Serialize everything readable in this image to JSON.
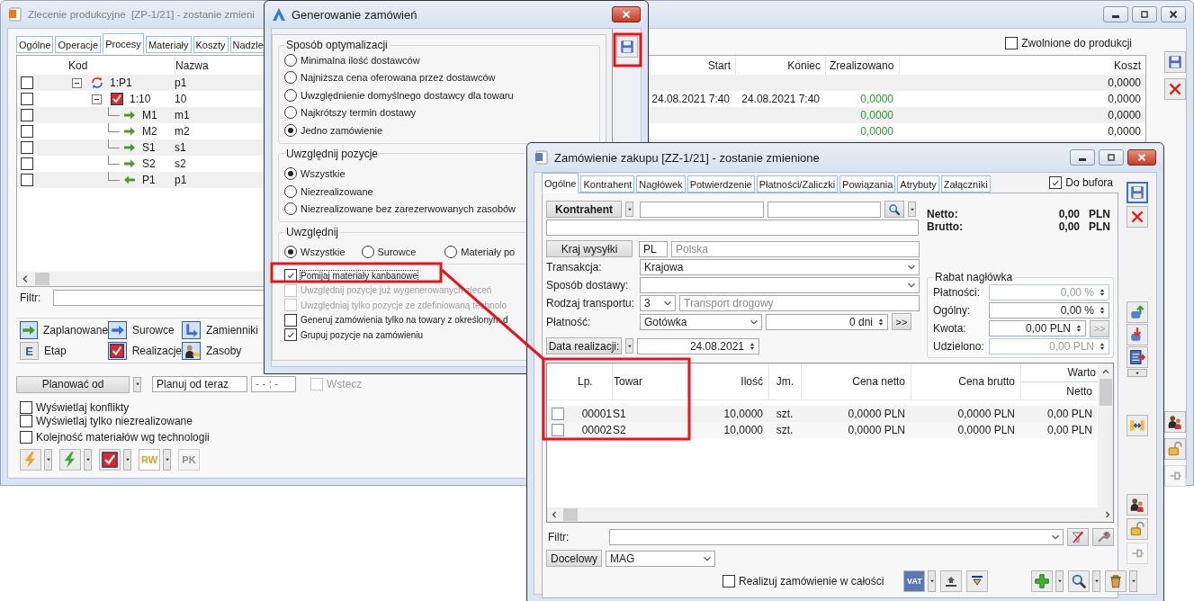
{
  "production_order_window": {
    "title": "Zlecenie produkcyjne  [ZP-1/21] - zostanie zmieni",
    "tabs": [
      {
        "label": "Ogólne",
        "selected": false
      },
      {
        "label": "Operacje",
        "selected": false
      },
      {
        "label": "Procesy",
        "selected": true
      },
      {
        "label": "Materiały",
        "selected": false
      },
      {
        "label": "Koszty",
        "selected": false
      },
      {
        "label": "Nadzle",
        "selected": false
      }
    ],
    "released": {
      "label": "Zwolnione do produkcji",
      "checked": false
    },
    "columns": [
      "Kod",
      "Nazwa",
      "Start",
      "Koniec",
      "Zrealizowano",
      "Koszt"
    ],
    "tree": [
      {
        "kind": "process",
        "code": "1:P1",
        "name": "p1",
        "checked": false,
        "expanded": true,
        "cost": "0,0000",
        "children": [
          {
            "kind": "operation",
            "code": "1:10",
            "name": "10",
            "checked": false,
            "expanded": true,
            "start": "24.08.2021 7:40",
            "end": "24.08.2021 7:40",
            "done": "0,0000",
            "cost": "0,0000",
            "children": [
              {
                "kind": "input",
                "code": "M1",
                "name": "m1",
                "checked": false,
                "done": "0,0000",
                "cost": "0,0000"
              },
              {
                "kind": "input",
                "code": "M2",
                "name": "m2",
                "checked": false,
                "done": "0,0000",
                "cost": "0,0000"
              },
              {
                "kind": "input",
                "code": "S1",
                "name": "s1",
                "checked": false
              },
              {
                "kind": "input",
                "code": "S2",
                "name": "s2",
                "checked": false
              },
              {
                "kind": "output",
                "code": "P1",
                "name": "p1",
                "checked": false
              }
            ]
          }
        ]
      }
    ],
    "filter_label": "Filtr:",
    "legend": [
      {
        "label": "Zaplanowane",
        "kind": "planned"
      },
      {
        "label": "Surowce",
        "kind": "raw"
      },
      {
        "label": "Zamienniki",
        "kind": "substitutes"
      },
      {
        "label": "Etap",
        "kind": "stage",
        "glyph": "E"
      },
      {
        "label": "Realizacje",
        "kind": "realization"
      },
      {
        "label": "Zasoby",
        "kind": "resources"
      }
    ],
    "plan_button": "Planować od",
    "plan_mode": "Planuj od teraz",
    "plan_time": "- - : -",
    "backward": {
      "label": "Wstecz",
      "checked": false,
      "disabled": true
    },
    "options": [
      {
        "label": "Wyświetlaj konflikty",
        "checked": false
      },
      {
        "label": "Wyświetlaj tylko niezrealizowane",
        "checked": false
      },
      {
        "label": "Kolejność materiałów wg technologii",
        "checked": false
      }
    ],
    "tools": [
      {
        "kind": "lightning",
        "color": "#f0a028",
        "dropdown": true,
        "disabled": false
      },
      {
        "kind": "lightning",
        "color": "#38a838",
        "dropdown": true,
        "disabled": false
      },
      {
        "kind": "realization",
        "dropdown": true,
        "disabled": false
      },
      {
        "kind": "document",
        "glyph": "RW",
        "dropdown": true,
        "disabled": false
      },
      {
        "kind": "document",
        "glyph": "PK",
        "dropdown": false,
        "disabled": true
      }
    ],
    "side_tools": [
      [
        {
          "kind": "save",
          "disabled": false
        },
        {
          "kind": "delete",
          "disabled": false
        }
      ],
      [
        {
          "kind": "people",
          "disabled": false
        },
        {
          "kind": "lock",
          "disabled": false
        },
        {
          "kind": "pin",
          "disabled": true
        }
      ]
    ]
  },
  "dialog": {
    "title": "Generowanie zamówień",
    "groups": [
      {
        "title": "Sposób optymalizacji",
        "kind": "column",
        "options": [
          {
            "label": "Minimalna ilość dostawców",
            "selected": false
          },
          {
            "label": "Najniższa cena oferowana przez dostawców",
            "selected": false
          },
          {
            "label": "Uwzględnienie domyślnego dostawcy dla towaru",
            "selected": false
          },
          {
            "label": "Najkrótszy termin dostawy",
            "selected": false
          },
          {
            "label": "Jedno zamówienie",
            "selected": true
          }
        ]
      },
      {
        "title": "Uwzględnij pozycje",
        "kind": "column",
        "options": [
          {
            "label": "Wszystkie",
            "selected": true
          },
          {
            "label": "Niezrealizowane",
            "selected": false
          },
          {
            "label": "Niezrealizowane bez zarezerwowanych zasobów",
            "selected": false
          }
        ]
      },
      {
        "title": "Uwzględnij",
        "kind": "row",
        "options": [
          {
            "label": "Wszystkie",
            "selected": true
          },
          {
            "label": "Surowce",
            "selected": false
          },
          {
            "label": "Materiały po",
            "selected": false
          }
        ]
      }
    ],
    "checkboxes": [
      {
        "label": "Pomijaj materiały kanbanowe",
        "checked": true,
        "disabled": false,
        "focused": true
      },
      {
        "label": "Uwzględnij pozycje już wygenerowanych zleceń",
        "checked": false,
        "disabled": true,
        "focused": false
      },
      {
        "label": "Uwzględniaj tylko pozycje ze zdefiniowaną technolo",
        "checked": false,
        "disabled": true,
        "focused": false
      },
      {
        "label": "Generuj zamówienia tylko na towary z określonym d",
        "checked": false,
        "disabled": false,
        "focused": false
      },
      {
        "label": "Grupuj pozycje na zamówieniu",
        "checked": true,
        "disabled": false,
        "focused": false
      }
    ]
  },
  "purchase_order_window": {
    "title": "Zamówienie zakupu [ZZ-1/21] - zostanie zmienione",
    "tabs": [
      {
        "label": "Ogólne",
        "selected": true
      },
      {
        "label": "Kontrahent",
        "selected": false
      },
      {
        "label": "Nagłówek",
        "selected": false
      },
      {
        "label": "Potwierdzenie",
        "selected": false
      },
      {
        "label": "Płatności/Zaliczki",
        "selected": false
      },
      {
        "label": "Powiązania",
        "selected": false
      },
      {
        "label": "Atrybuty",
        "selected": false
      },
      {
        "label": "Załączniki",
        "selected": false
      }
    ],
    "buffer": {
      "label": "Do bufora",
      "checked": true
    },
    "contractor_button": "Kontrahent",
    "country_button": "Kraj wysyłki",
    "country_code": "PL",
    "country_name": "Polska",
    "transaction": {
      "label": "Transakcja:",
      "value": "Krajowa"
    },
    "delivery": {
      "label": "Sposób dostawy:"
    },
    "transport": {
      "label": "Rodzaj transportu:",
      "code": "3",
      "name": "Transport drogowy"
    },
    "payment": {
      "label": "Płatność:",
      "value": "Gotówka",
      "days": "0 dni",
      "more": ">>"
    },
    "date_button": "Data realizacji:",
    "date": "24.08.2021",
    "totals": [
      {
        "label": "Netto:",
        "value": "0,00",
        "currency": "PLN"
      },
      {
        "label": "Brutto:",
        "value": "0,00",
        "currency": "PLN"
      }
    ],
    "discount": {
      "title": "Rabat nagłówka",
      "rows": [
        {
          "label": "Płatności:",
          "value": "0,00 %",
          "disabled": true
        },
        {
          "label": "Ogólny:",
          "value": "0,00 %",
          "disabled": false
        },
        {
          "label": "Kwota:",
          "value": "0,00 PLN",
          "disabled": false,
          "more": ">>"
        },
        {
          "label": "Udzielono:",
          "value": "0,00 PLN",
          "disabled": true
        }
      ]
    },
    "table": {
      "columns": [
        "Lp.",
        "Towar",
        "Ilość",
        "Jm.",
        "Cena netto",
        "Cena brutto"
      ],
      "group_header": "Warto",
      "sub_header": "Netto",
      "rows": [
        {
          "checked": false,
          "lp": "00001",
          "item": "S1",
          "qty": "10,0000",
          "unit": "szt.",
          "net_price": "0,0000 PLN",
          "gross_price": "0,0000 PLN",
          "net_value": "0,00 PLN"
        },
        {
          "checked": false,
          "lp": "00002",
          "item": "S2",
          "qty": "10,0000",
          "unit": "szt.",
          "net_price": "0,0000 PLN",
          "gross_price": "0,0000 PLN",
          "net_value": "0,00 PLN"
        }
      ]
    },
    "filter_label": "Filtr:",
    "target_button": "Docelowy",
    "warehouse": "MAG",
    "complete": {
      "label": "Realizuj zamówienie w całości",
      "checked": false
    },
    "tools_left": [
      {
        "kind": "vat",
        "glyph": "VAT",
        "dropdown": true
      },
      {
        "kind": "export",
        "dropdown": false
      },
      {
        "kind": "import",
        "dropdown": false
      }
    ],
    "tools_right": [
      {
        "kind": "add",
        "dropdown": true
      },
      {
        "kind": "search",
        "dropdown": true
      },
      {
        "kind": "trash",
        "dropdown": true
      }
    ],
    "side_tools": [
      [
        {
          "kind": "save",
          "disabled": false
        },
        {
          "kind": "delete",
          "disabled": false
        }
      ],
      [
        {
          "kind": "dbup",
          "disabled": false
        },
        {
          "kind": "dbdown",
          "disabled": false
        },
        {
          "kind": "calc",
          "disabled": false,
          "dropdown": true
        }
      ],
      [
        {
          "kind": "link",
          "disabled": false
        }
      ],
      [
        {
          "kind": "people",
          "disabled": false
        },
        {
          "kind": "lock",
          "disabled": false
        },
        {
          "kind": "pin",
          "disabled": true
        }
      ]
    ]
  }
}
